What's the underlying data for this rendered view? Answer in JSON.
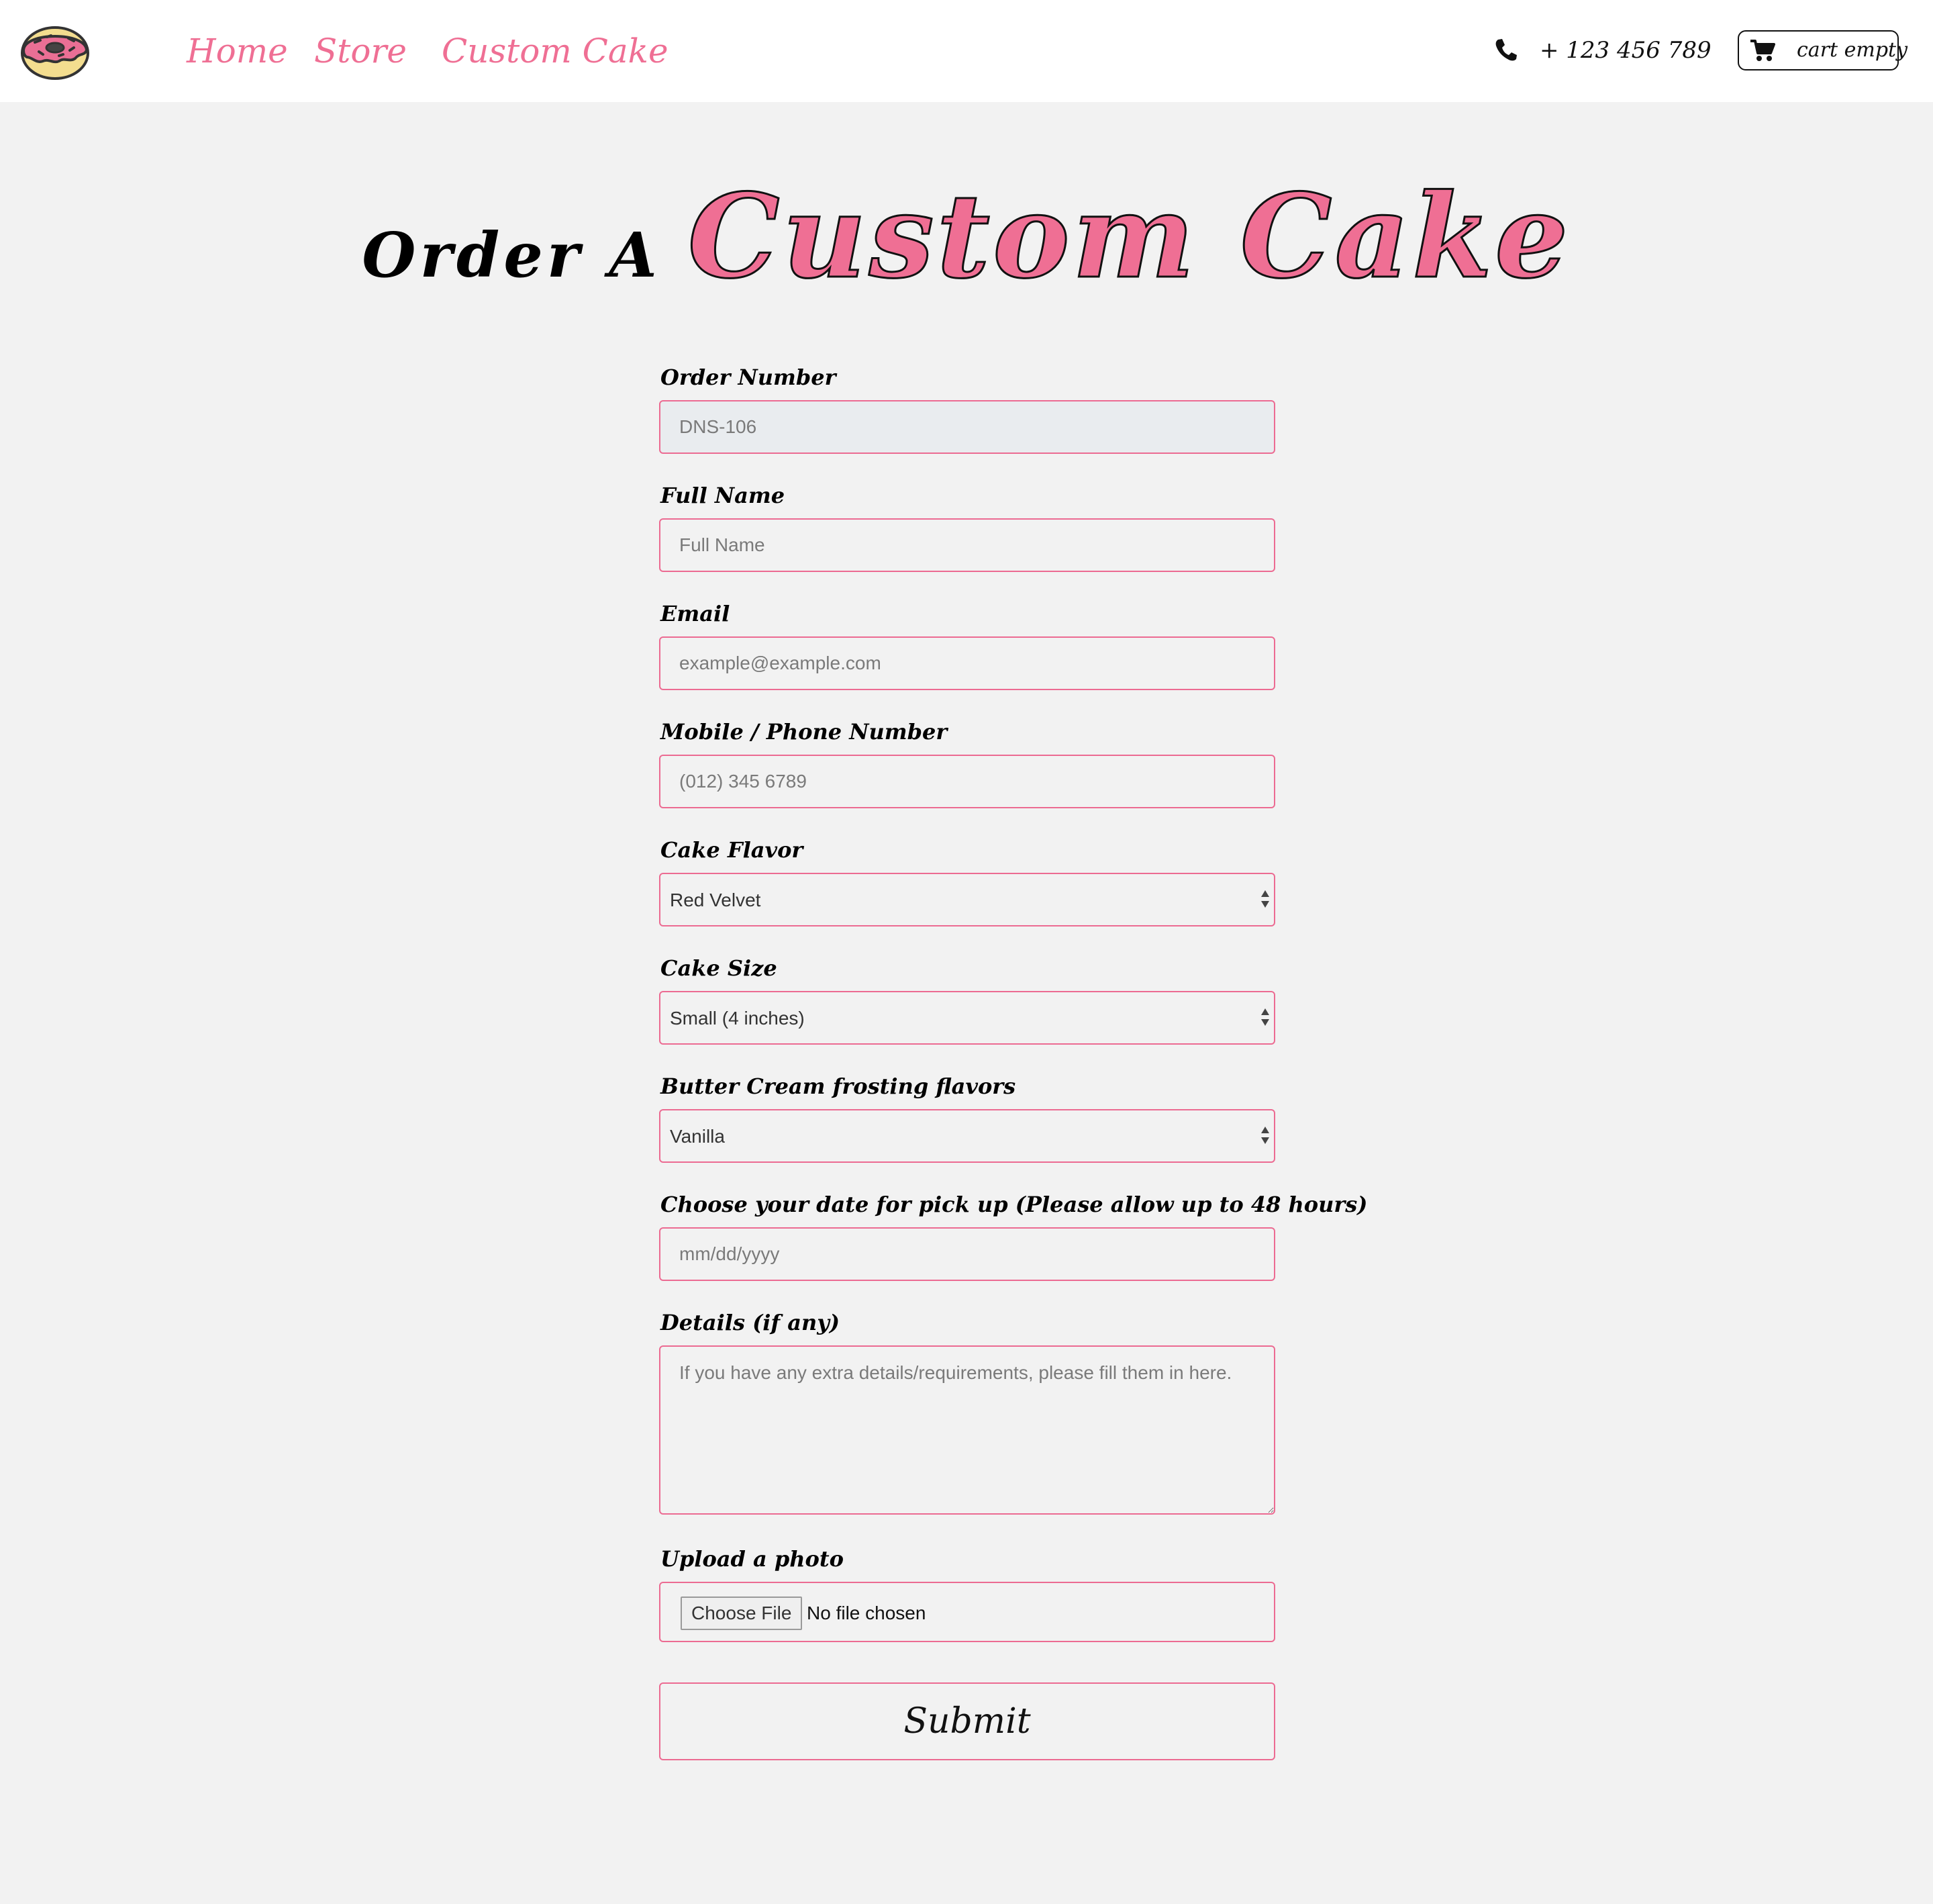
{
  "nav": {
    "links": [
      "Home",
      "Store",
      "Custom Cake"
    ],
    "phone": "+ 123 456 789",
    "cart_label": "cart empty"
  },
  "heading": {
    "prefix": "Order A",
    "main": "Custom Cake"
  },
  "form": {
    "order_number": {
      "label": "Order Number",
      "value": "DNS-106"
    },
    "full_name": {
      "label": "Full Name",
      "placeholder": "Full Name"
    },
    "email": {
      "label": "Email",
      "placeholder": "example@example.com"
    },
    "phone": {
      "label": "Mobile / Phone Number",
      "placeholder": "(012) 345 6789"
    },
    "flavor": {
      "label": "Cake Flavor",
      "selected": "Red Velvet"
    },
    "size": {
      "label": "Cake Size",
      "selected": "Small (4 inches)"
    },
    "frosting": {
      "label": "Butter Cream frosting flavors",
      "selected": "Vanilla"
    },
    "pickup_date": {
      "label": "Choose your date for pick up (Please allow up to 48 hours)",
      "placeholder": "mm/dd/yyyy"
    },
    "details": {
      "label": "Details (if any)",
      "placeholder": "If you have any extra details/requirements, please fill them in here."
    },
    "photo": {
      "label": "Upload a photo",
      "button": "Choose File",
      "status": "No file chosen"
    },
    "submit": "Submit"
  },
  "colors": {
    "accent_pink": "#ef6f94",
    "field_border": "#ec6b92",
    "page_background": "#f2f2f2",
    "navbar_background": "#ffffff"
  },
  "icons": {
    "logo": "donut-logo",
    "phone": "phone-icon",
    "cart": "cart-icon",
    "select": "updown-arrows-icon"
  }
}
